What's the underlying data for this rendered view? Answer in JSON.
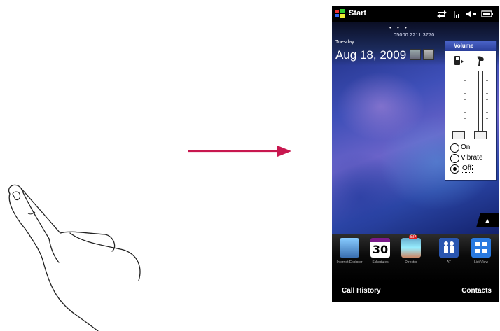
{
  "statusbar": {
    "start_label": "Start",
    "icons": [
      "windows-flag-icon",
      "sync-arrows-icon",
      "signal-icon",
      "volume-icon",
      "battery-icon"
    ]
  },
  "today": {
    "page_dots": "• • •",
    "phone_number": "05000 2211 3770",
    "day": "Tuesday",
    "date": "Aug 18, 2009"
  },
  "volume": {
    "title": "Volume",
    "ringer_level": 0,
    "speaker_level": 0,
    "options": [
      {
        "label": "On",
        "selected": false
      },
      {
        "label": "Vibrate",
        "selected": false
      },
      {
        "label": "Off",
        "selected": true
      }
    ]
  },
  "tabs": [
    {
      "caption": "Internet Explorer",
      "icon": "internet-icon"
    },
    {
      "caption": "Schedules",
      "icon": "calendar-icon",
      "number": "30"
    },
    {
      "caption": "Director",
      "icon": "photos-icon",
      "badge": "EP"
    },
    {
      "caption": "AT",
      "icon": "people-icon"
    },
    {
      "caption": "List View",
      "icon": "grid-icon"
    }
  ],
  "collapse_glyph": "▲",
  "softkeys": {
    "left": "Call History",
    "right": "Contacts"
  },
  "colors": {
    "arrow": "#c8174f",
    "title_bar": "#2a3e9a",
    "screen_bg": "#000000"
  }
}
